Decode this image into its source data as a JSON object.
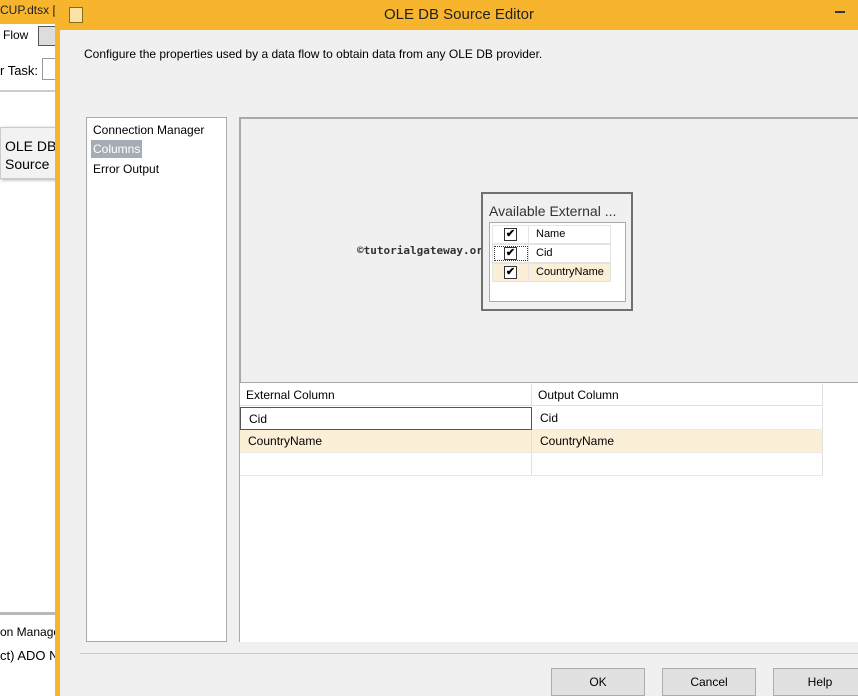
{
  "background_app": {
    "doc_tab": "CUP.dtsx [D",
    "flow_tab": "Flow",
    "task_label": "r Task:",
    "component_line1": "OLE DB",
    "component_line2": "Source",
    "connection_header": "on Manage",
    "connection_item": "ct) ADO N"
  },
  "dialog": {
    "title": "OLE DB Source Editor",
    "description": "Configure the properties used by a data flow to obtain data from any OLE DB provider."
  },
  "nav": {
    "items": [
      {
        "label": "Connection Manager"
      },
      {
        "label": "Columns"
      },
      {
        "label": "Error Output"
      }
    ],
    "selected": "Columns"
  },
  "watermark": "©tutorialgateway.org",
  "available_columns": {
    "title": "Available External ...",
    "rows": [
      {
        "label": "Name",
        "checked": true
      },
      {
        "label": "Cid",
        "checked": true
      },
      {
        "label": "CountryName",
        "checked": true
      }
    ]
  },
  "mapping_grid": {
    "headers": [
      "External Column",
      "Output Column"
    ],
    "rows": [
      [
        "Cid",
        "Cid"
      ],
      [
        "CountryName",
        "CountryName"
      ]
    ]
  },
  "buttons": {
    "ok": "OK",
    "cancel": "Cancel",
    "help": "Help"
  },
  "colors": {
    "titlebar": "#f7b52e",
    "selection_highlight": "#fcefd8",
    "nav_selected": "#a5acb5"
  },
  "glyphs": {
    "check": "✔"
  }
}
